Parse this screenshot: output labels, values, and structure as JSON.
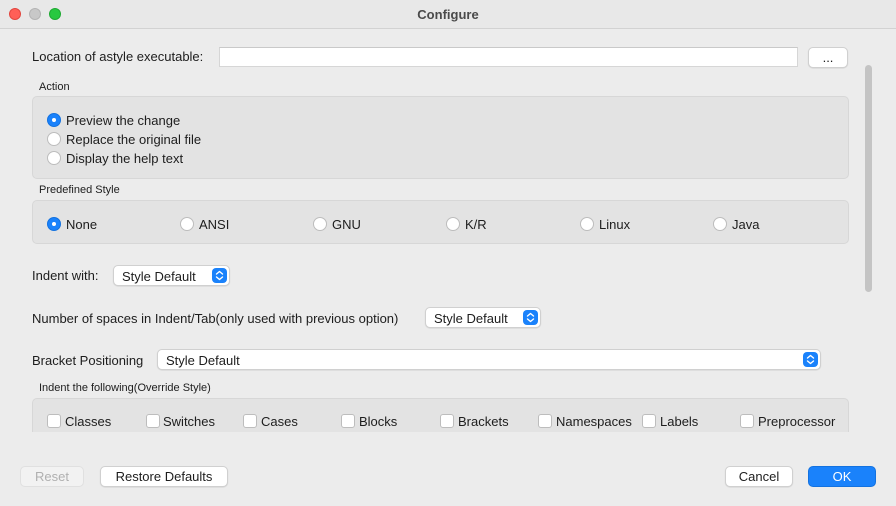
{
  "window": {
    "title": "Configure"
  },
  "executable": {
    "label": "Location of astyle executable:",
    "value": "",
    "browse_label": "..."
  },
  "action": {
    "heading": "Action",
    "options": [
      "Preview the change",
      "Replace the original file",
      "Display the help text"
    ],
    "selected": "Preview the change"
  },
  "predefined_style": {
    "heading": "Predefined Style",
    "options": [
      "None",
      "ANSI",
      "GNU",
      "K/R",
      "Linux",
      "Java"
    ],
    "selected": "None"
  },
  "indent_with": {
    "label": "Indent with:",
    "value": "Style Default"
  },
  "spaces": {
    "label": "Number of spaces in Indent/Tab(only used with previous option)",
    "value": "Style Default"
  },
  "bracket": {
    "label": "Bracket Positioning",
    "value": "Style Default"
  },
  "indent_following": {
    "heading": "Indent the following(Override Style)",
    "options": [
      "Classes",
      "Switches",
      "Cases",
      "Blocks",
      "Brackets",
      "Namespaces",
      "Labels",
      "Preprocessor"
    ]
  },
  "footer": {
    "reset_label": "Reset",
    "restore_label": "Restore Defaults",
    "cancel_label": "Cancel",
    "ok_label": "OK"
  },
  "colors": {
    "accent": "#1a82fb",
    "close": "#ff5f57",
    "maximize": "#28c840"
  }
}
